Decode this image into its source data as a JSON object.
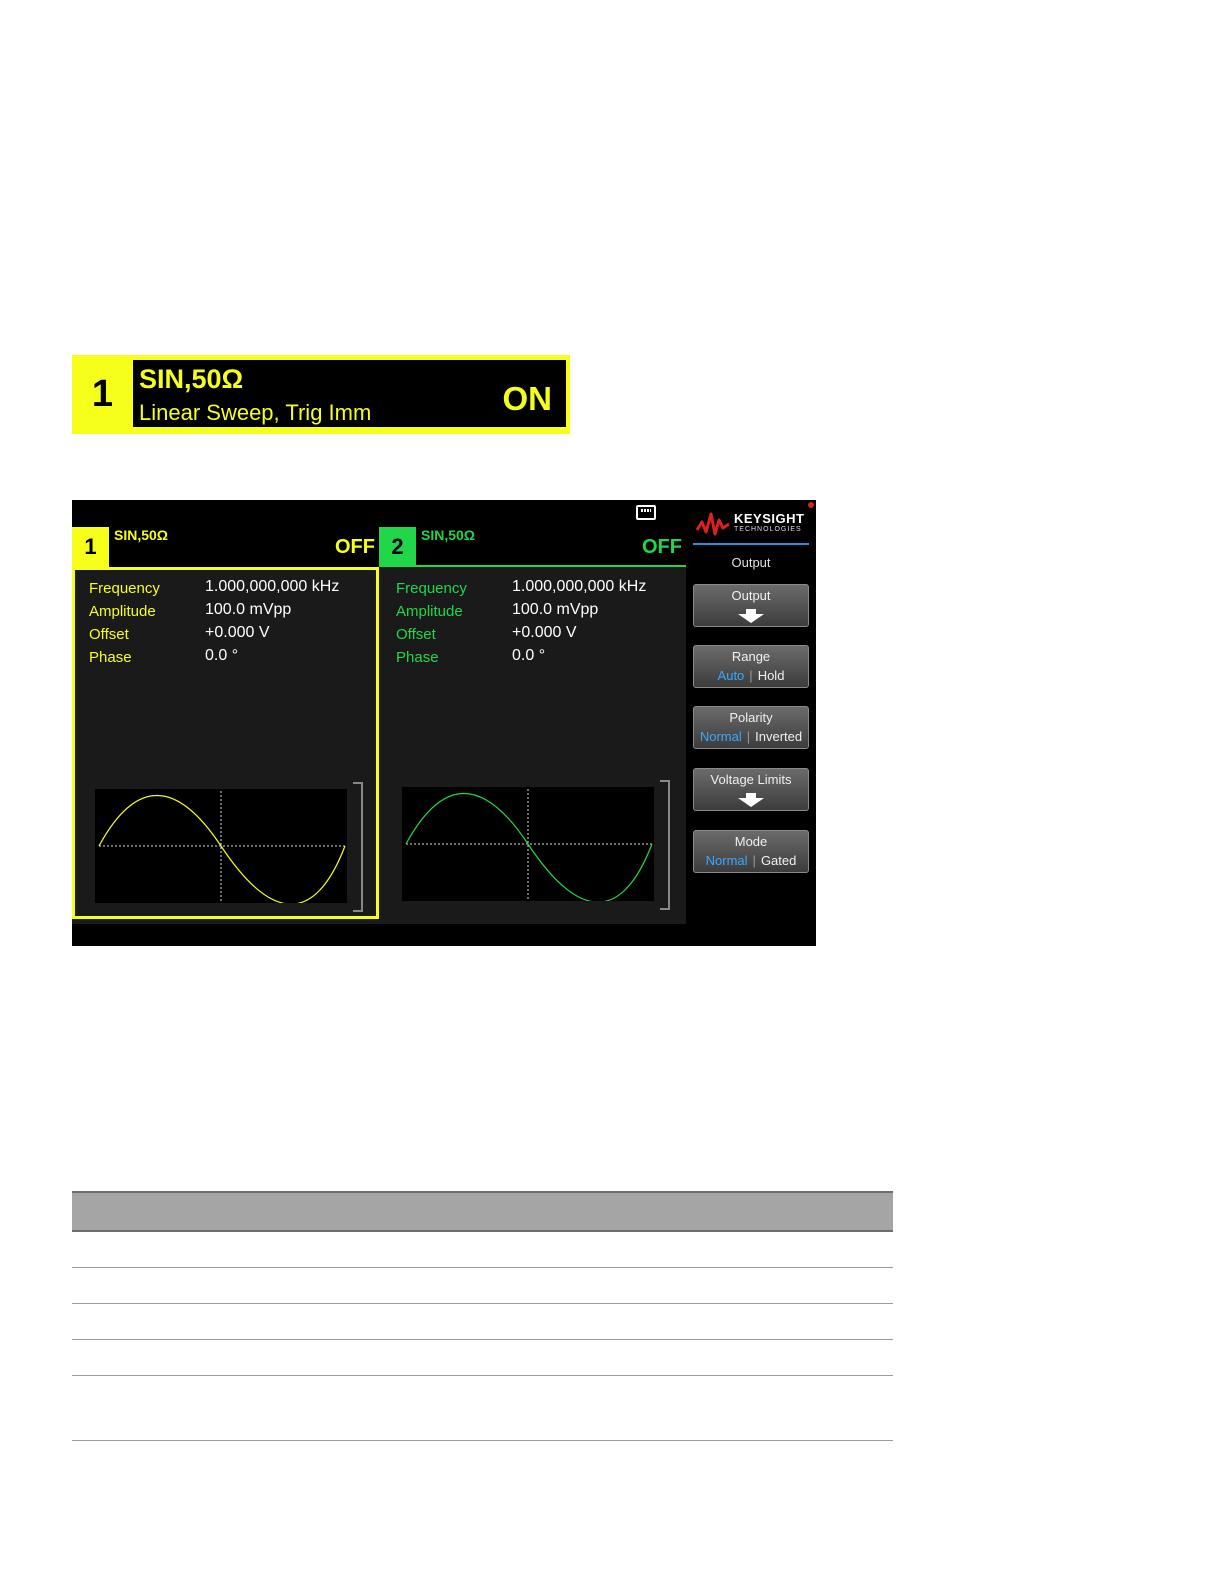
{
  "banner": {
    "channel": "1",
    "waveform": "SIN,50Ω",
    "mode": "Linear Sweep, Trig Imm",
    "state": "ON"
  },
  "channels": [
    {
      "number": "1",
      "waveform": "SIN,50Ω",
      "state": "OFF",
      "color": "#f5ff1a",
      "params": [
        {
          "label": "Frequency",
          "value": "1.000,000,000 kHz"
        },
        {
          "label": "Amplitude",
          "value": "100.0 mVpp"
        },
        {
          "label": "Offset",
          "value": "+0.000 V"
        },
        {
          "label": "Phase",
          "value": "0.0 °"
        }
      ]
    },
    {
      "number": "2",
      "waveform": "SIN,50Ω",
      "state": "OFF",
      "color": "#22d64a",
      "params": [
        {
          "label": "Frequency",
          "value": "1.000,000,000 kHz"
        },
        {
          "label": "Amplitude",
          "value": "100.0 mVpp"
        },
        {
          "label": "Offset",
          "value": "+0.000 V"
        },
        {
          "label": "Phase",
          "value": "0.0 °"
        }
      ]
    }
  ],
  "menu": {
    "brand": "KEYSIGHT",
    "brand_sub": "TECHNOLOGIES",
    "title": "Output",
    "softkeys": [
      {
        "label": "Output",
        "type": "submenu",
        "icon": "down-arrow-icon"
      },
      {
        "label": "Range",
        "type": "toggle",
        "options": [
          "Auto",
          "Hold"
        ],
        "selected": "Auto"
      },
      {
        "label": "Polarity",
        "type": "toggle",
        "options": [
          "Normal",
          "Inverted"
        ],
        "selected": "Normal"
      },
      {
        "label": "Voltage Limits",
        "type": "submenu",
        "icon": "down-arrow-icon"
      },
      {
        "label": "Mode",
        "type": "toggle",
        "options": [
          "Normal",
          "Gated"
        ],
        "selected": "Normal"
      }
    ],
    "accent_color": "#3aa8ff"
  },
  "table": {
    "header": [],
    "rows": [
      [],
      [],
      [],
      [],
      []
    ]
  }
}
